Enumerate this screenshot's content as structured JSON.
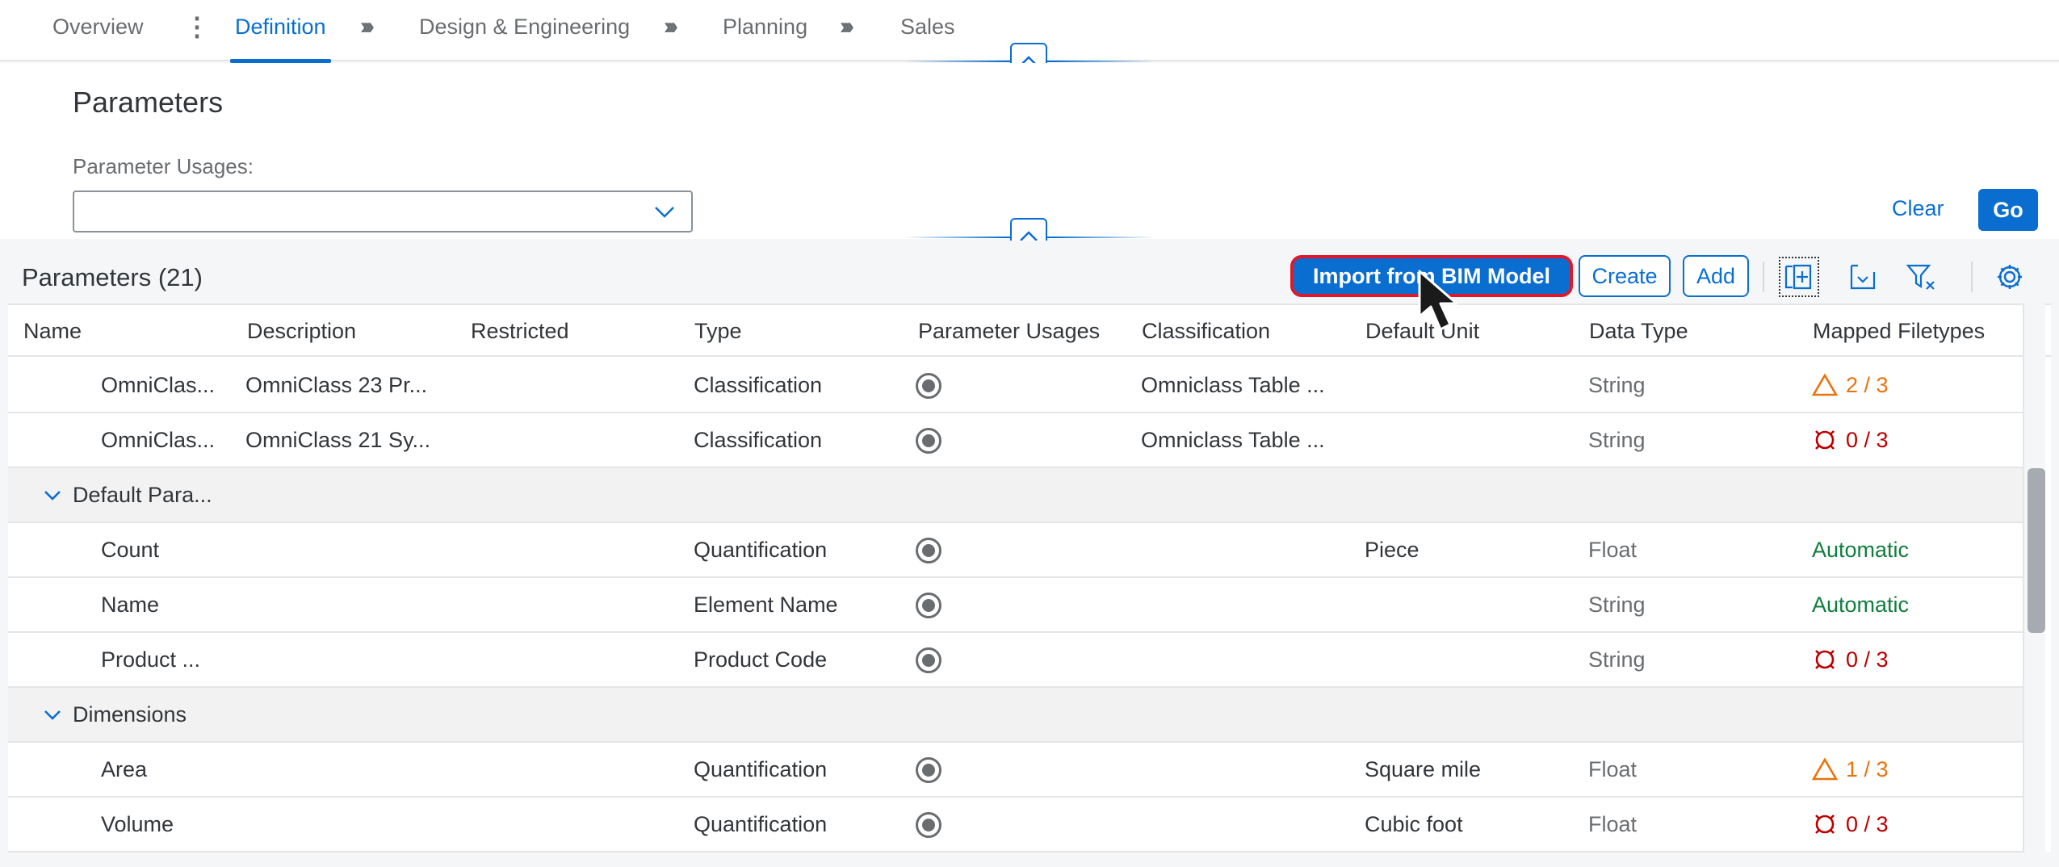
{
  "tabs": [
    {
      "label": "Overview",
      "active": false
    },
    {
      "label": "Definition",
      "active": true
    },
    {
      "label": "Design & Engineering",
      "active": false
    },
    {
      "label": "Planning",
      "active": false
    },
    {
      "label": "Sales",
      "active": false
    }
  ],
  "header": {
    "title": "Parameters",
    "filter_label": "Parameter Usages:",
    "filter_value": "",
    "clear_label": "Clear",
    "go_label": "Go"
  },
  "toolbar": {
    "title": "Parameters (21)",
    "import_label": "Import from BIM Model",
    "create_label": "Create",
    "add_label": "Add"
  },
  "columns": [
    "Name",
    "Description",
    "Restricted",
    "Type",
    "Parameter Usages",
    "Classification",
    "Default Unit",
    "Data Type",
    "Mapped Filetypes"
  ],
  "rows": [
    {
      "name": "OmniClas...",
      "description": "OmniClass 23 Pr...",
      "type": "Classification",
      "classification": "Omniclass Table ...",
      "unit": "",
      "datatype": "String",
      "mapped": "2 / 3",
      "status": "warning"
    },
    {
      "name": "OmniClas...",
      "description": "OmniClass 21 Sy...",
      "type": "Classification",
      "classification": "Omniclass Table ...",
      "unit": "",
      "datatype": "String",
      "mapped": "0 / 3",
      "status": "error"
    },
    {
      "group": "Default Para..."
    },
    {
      "name": "Count",
      "description": "",
      "type": "Quantification",
      "classification": "",
      "unit": "Piece",
      "datatype": "Float",
      "mapped": "Automatic",
      "status": "success"
    },
    {
      "name": "Name",
      "description": "",
      "type": "Element Name",
      "classification": "",
      "unit": "",
      "datatype": "String",
      "mapped": "Automatic",
      "status": "success"
    },
    {
      "name": "Product ...",
      "description": "",
      "type": "Product Code",
      "classification": "",
      "unit": "",
      "datatype": "String",
      "mapped": "0 / 3",
      "status": "error"
    },
    {
      "group": "Dimensions"
    },
    {
      "name": "Area",
      "description": "",
      "type": "Quantification",
      "classification": "",
      "unit": "Square mile",
      "datatype": "Float",
      "mapped": "1 / 3",
      "status": "warning"
    },
    {
      "name": "Volume",
      "description": "",
      "type": "Quantification",
      "classification": "",
      "unit": "Cubic foot",
      "datatype": "Float",
      "mapped": "0 / 3",
      "status": "error"
    }
  ],
  "colors": {
    "accent": "#0a6ed1",
    "success": "#107e3e",
    "warning": "#e9730c",
    "error": "#bb0000",
    "highlight": "#e0182d"
  },
  "icons": [
    "kebab-icon",
    "chevron-up-icon",
    "chevron-down-icon",
    "expand-all-icon",
    "collapse-all-icon",
    "clear-filter-icon",
    "settings-icon",
    "warning-icon",
    "error-icon",
    "cursor-icon"
  ]
}
